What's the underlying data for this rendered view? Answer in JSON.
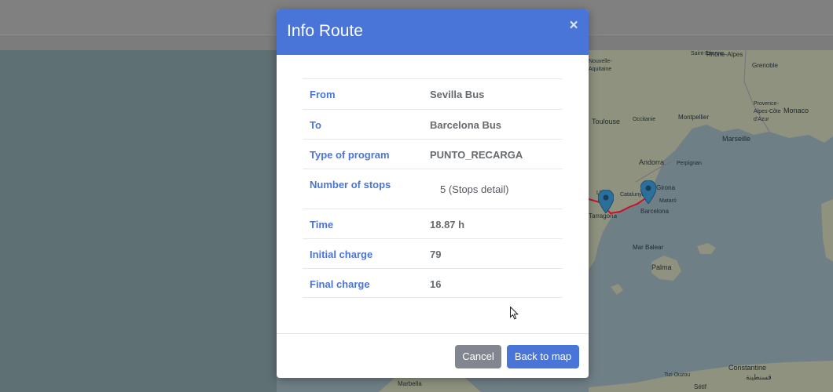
{
  "modal": {
    "title": "Info Route",
    "close_label": "×",
    "rows": [
      {
        "label": "From",
        "value": "Sevilla Bus"
      },
      {
        "label": "To",
        "value": "Barcelona Bus"
      },
      {
        "label": "Type of program",
        "value": "PUNTO_RECARGA"
      },
      {
        "label": "Number of stops",
        "value": "5 (Stops detail)"
      },
      {
        "label": "Time",
        "value": "18.87 h"
      },
      {
        "label": "Initial charge",
        "value": "79"
      },
      {
        "label": "Final charge",
        "value": "16"
      }
    ],
    "cancel_label": "Cancel",
    "back_label": "Back to map"
  },
  "map": {
    "places": [
      "Rhône-Alpes",
      "Grenoble",
      "Nouvelle-Aquitaine",
      "Toulouse",
      "Occitanie",
      "Montpellier",
      "Provence-Alpes-Côte d'Azur",
      "Monaco",
      "Marseille",
      "Andorra",
      "Perpignan",
      "Girona",
      "Catalunya",
      "Mataró",
      "Barcelona",
      "Tarragona",
      "Lleida",
      "Mar Balear",
      "Palma",
      "Marbella",
      "Constantine",
      "قسنطينة",
      "Sétif",
      "Tizi Ouzou",
      "Saint-Étienne"
    ],
    "colors": {
      "route": "#c8102e",
      "marker": "#2c6f9b",
      "land": "#b8bba8",
      "sea": "#8ea2ab"
    }
  }
}
